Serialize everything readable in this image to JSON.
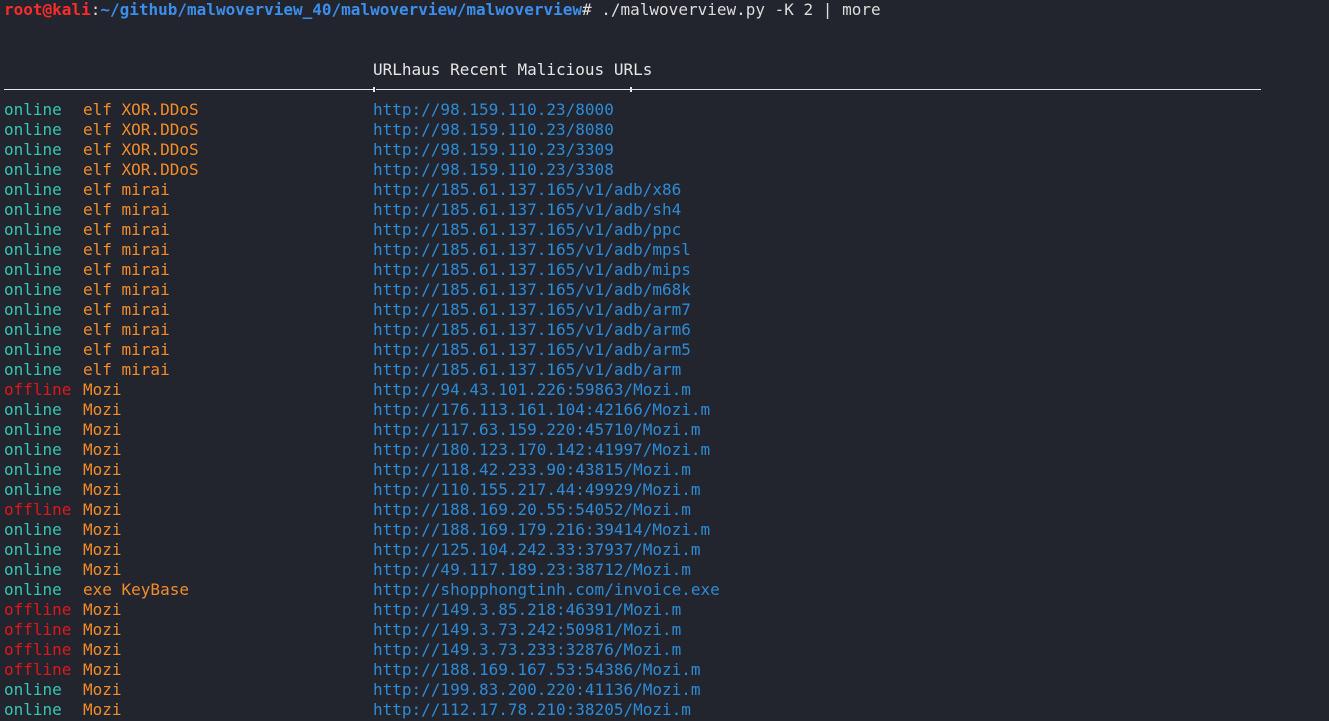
{
  "prompt": {
    "user_host": "root@kali",
    "separator": ":",
    "path": "~/github/malwoverview_40/malwoverview/malwoverview",
    "command": "# ./malwoverview.py -K 2 | more"
  },
  "header": {
    "title": "URLhaus Recent Malicious URLs"
  },
  "colors": {
    "background": "#23252e",
    "online": "#33c7b4",
    "offline": "#e0161b",
    "malware": "#f28c28",
    "url": "#2d8bd6",
    "prompt_user": "#ff2a2a",
    "prompt_path": "#3b8eea"
  },
  "rows": [
    {
      "status": "online",
      "malware": "elf XOR.DDoS",
      "url": "http://98.159.110.23/8000"
    },
    {
      "status": "online",
      "malware": "elf XOR.DDoS",
      "url": "http://98.159.110.23/8080"
    },
    {
      "status": "online",
      "malware": "elf XOR.DDoS",
      "url": "http://98.159.110.23/3309"
    },
    {
      "status": "online",
      "malware": "elf XOR.DDoS",
      "url": "http://98.159.110.23/3308"
    },
    {
      "status": "online",
      "malware": "elf mirai",
      "url": "http://185.61.137.165/v1/adb/x86"
    },
    {
      "status": "online",
      "malware": "elf mirai",
      "url": "http://185.61.137.165/v1/adb/sh4"
    },
    {
      "status": "online",
      "malware": "elf mirai",
      "url": "http://185.61.137.165/v1/adb/ppc"
    },
    {
      "status": "online",
      "malware": "elf mirai",
      "url": "http://185.61.137.165/v1/adb/mpsl"
    },
    {
      "status": "online",
      "malware": "elf mirai",
      "url": "http://185.61.137.165/v1/adb/mips"
    },
    {
      "status": "online",
      "malware": "elf mirai",
      "url": "http://185.61.137.165/v1/adb/m68k"
    },
    {
      "status": "online",
      "malware": "elf mirai",
      "url": "http://185.61.137.165/v1/adb/arm7"
    },
    {
      "status": "online",
      "malware": "elf mirai",
      "url": "http://185.61.137.165/v1/adb/arm6"
    },
    {
      "status": "online",
      "malware": "elf mirai",
      "url": "http://185.61.137.165/v1/adb/arm5"
    },
    {
      "status": "online",
      "malware": "elf mirai",
      "url": "http://185.61.137.165/v1/adb/arm"
    },
    {
      "status": "offline",
      "malware": "Mozi",
      "url": "http://94.43.101.226:59863/Mozi.m"
    },
    {
      "status": "online",
      "malware": "Mozi",
      "url": "http://176.113.161.104:42166/Mozi.m"
    },
    {
      "status": "online",
      "malware": "Mozi",
      "url": "http://117.63.159.220:45710/Mozi.m"
    },
    {
      "status": "online",
      "malware": "Mozi",
      "url": "http://180.123.170.142:41997/Mozi.m"
    },
    {
      "status": "online",
      "malware": "Mozi",
      "url": "http://118.42.233.90:43815/Mozi.m"
    },
    {
      "status": "online",
      "malware": "Mozi",
      "url": "http://110.155.217.44:49929/Mozi.m"
    },
    {
      "status": "offline",
      "malware": "Mozi",
      "url": "http://188.169.20.55:54052/Mozi.m"
    },
    {
      "status": "online",
      "malware": "Mozi",
      "url": "http://188.169.179.216:39414/Mozi.m"
    },
    {
      "status": "online",
      "malware": "Mozi",
      "url": "http://125.104.242.33:37937/Mozi.m"
    },
    {
      "status": "online",
      "malware": "Mozi",
      "url": "http://49.117.189.23:38712/Mozi.m"
    },
    {
      "status": "online",
      "malware": "exe KeyBase",
      "url": "http://shopphongtinh.com/invoice.exe"
    },
    {
      "status": "offline",
      "malware": "Mozi",
      "url": "http://149.3.85.218:46391/Mozi.m"
    },
    {
      "status": "offline",
      "malware": "Mozi",
      "url": "http://149.3.73.242:50981/Mozi.m"
    },
    {
      "status": "offline",
      "malware": "Mozi",
      "url": "http://149.3.73.233:32876/Mozi.m"
    },
    {
      "status": "offline",
      "malware": "Mozi",
      "url": "http://188.169.167.53:54386/Mozi.m"
    },
    {
      "status": "online",
      "malware": "Mozi",
      "url": "http://199.83.200.220:41136/Mozi.m"
    },
    {
      "status": "online",
      "malware": "Mozi",
      "url": "http://112.17.78.210:38205/Mozi.m"
    }
  ]
}
